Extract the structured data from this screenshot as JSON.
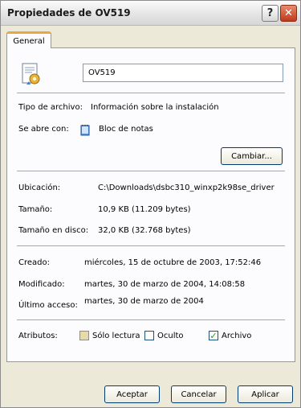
{
  "window": {
    "title": "Propiedades de OV519"
  },
  "titlebar": {
    "help_label": "?",
    "close_label": "✕"
  },
  "tabs": [
    {
      "label": "General"
    }
  ],
  "general": {
    "file_name_value": "OV519",
    "type": {
      "label": "Tipo de archivo:",
      "value": "Información sobre la instalación"
    },
    "opens_with": {
      "label": "Se abre con:",
      "value": "Bloc de notas",
      "icon": "notepad-icon"
    },
    "change_button": "Cambiar...",
    "location": {
      "label": "Ubicación:",
      "value": "C:\\Downloads\\dsbc310_winxp2k98se_driver"
    },
    "size": {
      "label": "Tamaño:",
      "value": "10,9 KB (11.209 bytes)"
    },
    "size_on_disk": {
      "label": "Tamaño en disco:",
      "value": "32,0 KB (32.768 bytes)"
    },
    "created": {
      "label": "Creado:",
      "value": "miércoles, 15 de octubre de 2003, 17:52:46"
    },
    "modified": {
      "label": "Modificado:",
      "value": "martes, 30 de marzo de 2004, 14:08:58"
    },
    "accessed": {
      "label": "Último acceso:",
      "value": "martes, 30 de marzo de 2004"
    },
    "attributes": {
      "label": "Atributos:",
      "read_only": {
        "label": "Sólo lectura",
        "checked": false
      },
      "hidden": {
        "label": "Oculto",
        "checked": false
      },
      "archive": {
        "label": "Archivo",
        "checked": true,
        "mark": "✓"
      }
    }
  },
  "buttons": {
    "ok": "Aceptar",
    "cancel": "Cancelar",
    "apply": "Aplicar"
  },
  "colors": {
    "tab_accent": "#e9a645",
    "close_red": "#c0391b",
    "check_green": "#21a121"
  }
}
